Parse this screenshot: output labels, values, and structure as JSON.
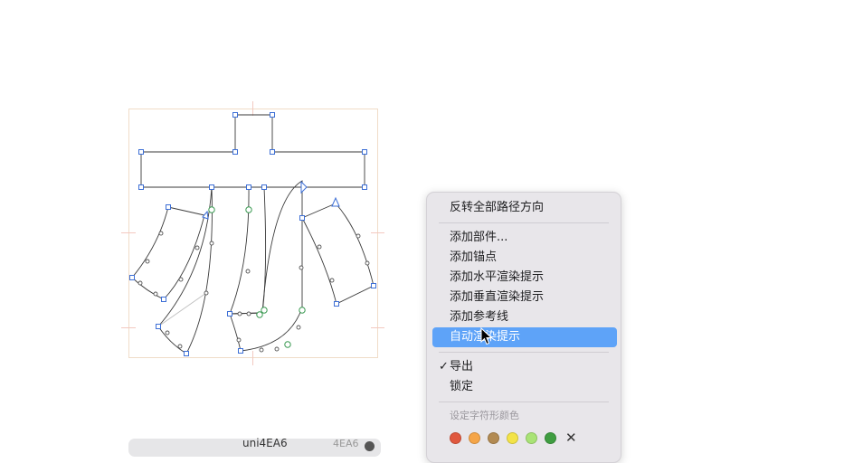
{
  "glyph_editor": {
    "glyph_name": "亦",
    "icons": [
      "on-curve-point",
      "off-curve-handle",
      "smooth-point",
      "start-point-arrow"
    ]
  },
  "context_menu": {
    "items": [
      {
        "label": "反转全部路径方向",
        "highlighted": false
      },
      {
        "label": "添加部件...",
        "highlighted": false
      },
      {
        "label": "添加锚点",
        "highlighted": false
      },
      {
        "label": "添加水平渲染提示",
        "highlighted": false
      },
      {
        "label": "添加垂直渲染提示",
        "highlighted": false
      },
      {
        "label": "添加参考线",
        "highlighted": false
      },
      {
        "label": "自动渲染提示",
        "highlighted": true
      },
      {
        "label": "导出",
        "checked": true
      },
      {
        "label": "锁定",
        "checked": false
      }
    ],
    "color_section_header": "设定字符形颜色",
    "colors": [
      "#e0583e",
      "#f5a548",
      "#b28a52",
      "#f3e348",
      "#a9e376",
      "#3f9d41"
    ],
    "clear_color_icon": "x-icon"
  },
  "bottom_panel": {
    "glyph_name": "uni4EA6",
    "code": "4EA6",
    "info_icon": "info-icon"
  }
}
